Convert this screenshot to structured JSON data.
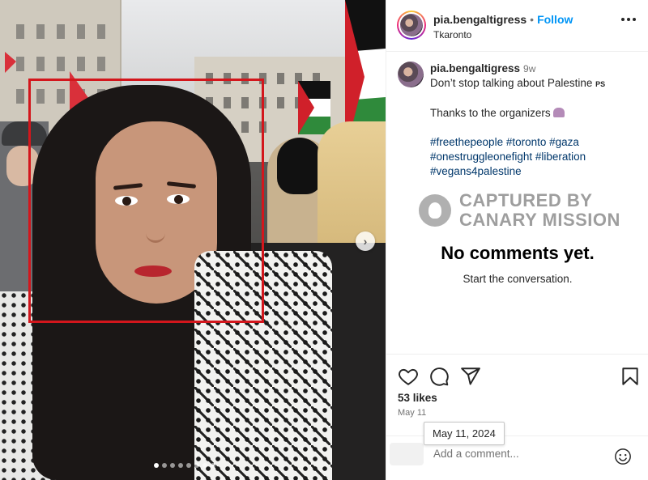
{
  "post": {
    "username": "pia.bengaltigress",
    "separator": "•",
    "follow_label": "Follow",
    "location": "Tkaronto",
    "caption": {
      "username": "pia.bengaltigress",
      "time": "9w",
      "line1": "Don’t stop talking about Palestine",
      "line1_flag": "PS",
      "line2": "Thanks to the organizers",
      "hashtags": [
        "#freethepeople",
        "#toronto",
        "#gaza",
        "#onestruggleonefight",
        "#liberation",
        "#vegans4palestine"
      ]
    },
    "watermark": {
      "line1": "CAPTURED BY",
      "line2": "CANARY MISSION"
    },
    "comments": {
      "empty_title": "No comments yet.",
      "empty_subtitle": "Start the conversation."
    },
    "likes": "53 likes",
    "date": "May 11",
    "date_tooltip": "May 11, 2024",
    "comment_placeholder": "Add a comment...",
    "carousel": {
      "count": 8,
      "active_index": 0
    }
  },
  "icons": {
    "like": "heart-icon",
    "comment": "comment-bubble-icon",
    "share": "paper-plane-icon",
    "save": "bookmark-icon",
    "more": "more-dots-icon",
    "emoji": "emoji-smiley-icon",
    "next": "chevron-right-icon"
  },
  "colors": {
    "follow": "#0095f6",
    "hashtag": "#00376b",
    "highlight_box": "#d3161c"
  }
}
